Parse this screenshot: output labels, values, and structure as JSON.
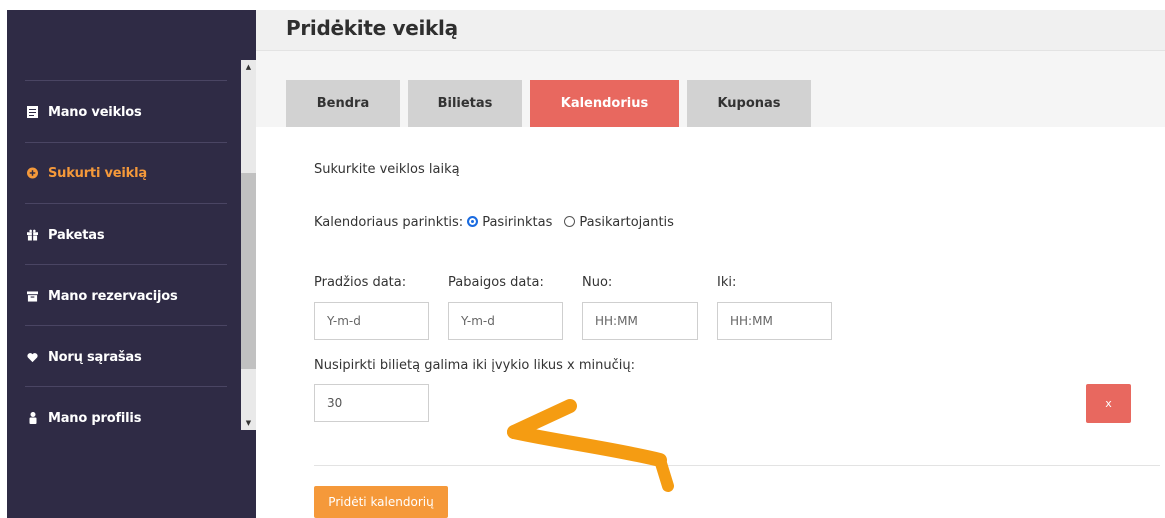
{
  "header": {
    "title": "Pridėkite veiklą"
  },
  "sidebar": {
    "items": [
      {
        "label": "Mano veiklos",
        "icon": "list-icon",
        "active": false
      },
      {
        "label": "Sukurti veiklą",
        "icon": "plus-circle-icon",
        "active": true
      },
      {
        "label": "Paketas",
        "icon": "gift-icon",
        "active": false
      },
      {
        "label": "Mano rezervacijos",
        "icon": "archive-icon",
        "active": false
      },
      {
        "label": "Norų sąrašas",
        "icon": "heart-icon",
        "active": false
      },
      {
        "label": "Mano profilis",
        "icon": "user-icon",
        "active": false
      }
    ]
  },
  "tabs": [
    {
      "label": "Bendra",
      "active": false
    },
    {
      "label": "Bilietas",
      "active": false
    },
    {
      "label": "Kalendorius",
      "active": true
    },
    {
      "label": "Kuponas",
      "active": false
    }
  ],
  "form": {
    "section_title": "Sukurkite veiklos laiką",
    "calendar_option_label": "Kalendoriaus parinktis:",
    "option_selected": "Pasirinktas",
    "option_recurring": "Pasikartojantis",
    "start_date_label": "Pradžios data:",
    "start_date_placeholder": "Y-m-d",
    "end_date_label": "Pabaigos data:",
    "end_date_placeholder": "Y-m-d",
    "from_label": "Nuo:",
    "from_placeholder": "HH:MM",
    "to_label": "Iki:",
    "to_placeholder": "HH:MM",
    "minutes_label": "Nusipirkti bilietą galima iki įvykio likus x minučių:",
    "minutes_value": "30",
    "remove_label": "x",
    "add_calendar_label": "Pridėti kalendorių"
  },
  "colors": {
    "sidebar_bg": "#2f2b45",
    "accent_orange": "#f5993a",
    "tab_active": "#e8685f",
    "annotation_arrow": "#f59c12"
  }
}
